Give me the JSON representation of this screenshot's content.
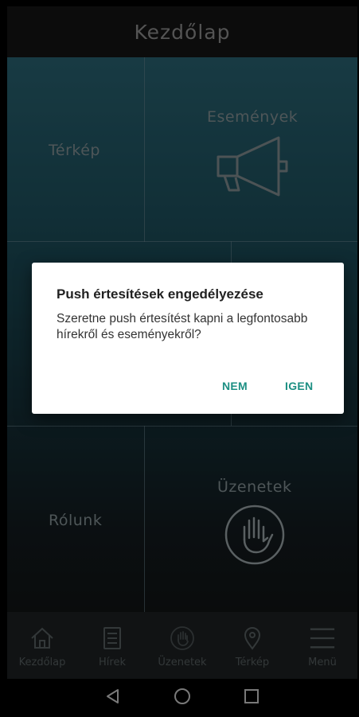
{
  "appbar": {
    "title": "Kezdőlap"
  },
  "tiles": {
    "map": "Térkép",
    "events": "Események",
    "about": "Rólunk",
    "messages": "Üzenetek"
  },
  "dialog": {
    "title": "Push értesítések engedélyezése",
    "body": "Szeretne push értesítést kapni a legfontosabb hírekről és eseményekről?",
    "no": "NEM",
    "yes": "IGEN"
  },
  "bottom_nav": {
    "items": [
      {
        "label": "Kezdőlap",
        "icon": "home-icon"
      },
      {
        "label": "Hírek",
        "icon": "news-icon"
      },
      {
        "label": "Üzenetek",
        "icon": "hand-icon"
      },
      {
        "label": "Térkép",
        "icon": "map-pin-icon"
      },
      {
        "label": "Menü",
        "icon": "menu-icon"
      }
    ]
  },
  "system_nav": [
    "back-icon",
    "home-circle-icon",
    "recents-icon"
  ],
  "colors": {
    "accent": "#1c8f83",
    "grid_top": "#2c6b7b",
    "grid_bottom": "#131617",
    "appbar": "#161616",
    "bottom_nav": "#1f2325"
  }
}
